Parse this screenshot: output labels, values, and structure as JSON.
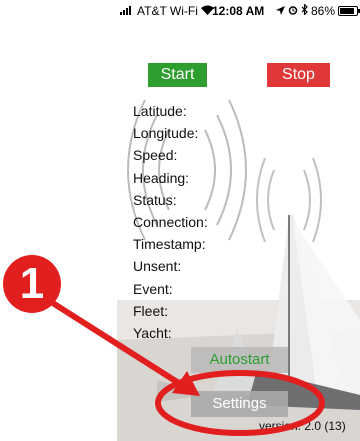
{
  "status_bar": {
    "carrier": "AT&T Wi-Fi",
    "time": "12:08 AM",
    "battery_text": "86%",
    "battery_level": 0.86,
    "icons": [
      "signal-bars-icon",
      "wifi-icon",
      "location-arrow-icon",
      "alarm-icon",
      "bluetooth-icon",
      "battery-icon"
    ]
  },
  "controls": {
    "start_label": "Start",
    "stop_label": "Stop",
    "autostart_label": "Autostart",
    "settings_label": "Settings"
  },
  "fields": [
    {
      "label": "Latitude:"
    },
    {
      "label": "Longitude:"
    },
    {
      "label": "Speed:"
    },
    {
      "label": "Heading:"
    },
    {
      "label": "Status:"
    },
    {
      "label": "Connection:"
    },
    {
      "label": "Timestamp:"
    },
    {
      "label": "Unsent:"
    },
    {
      "label": "Event:"
    },
    {
      "label": "Fleet:"
    },
    {
      "label": "Yacht:"
    }
  ],
  "version": "version: 2.0 (13)",
  "annotation": {
    "step_number": "1",
    "color": "#e21f1f"
  },
  "colors": {
    "start": "#2e9e2e",
    "stop": "#e03838",
    "autostart_text": "#2e9e2e",
    "button_gray": "#b9b9b9"
  }
}
